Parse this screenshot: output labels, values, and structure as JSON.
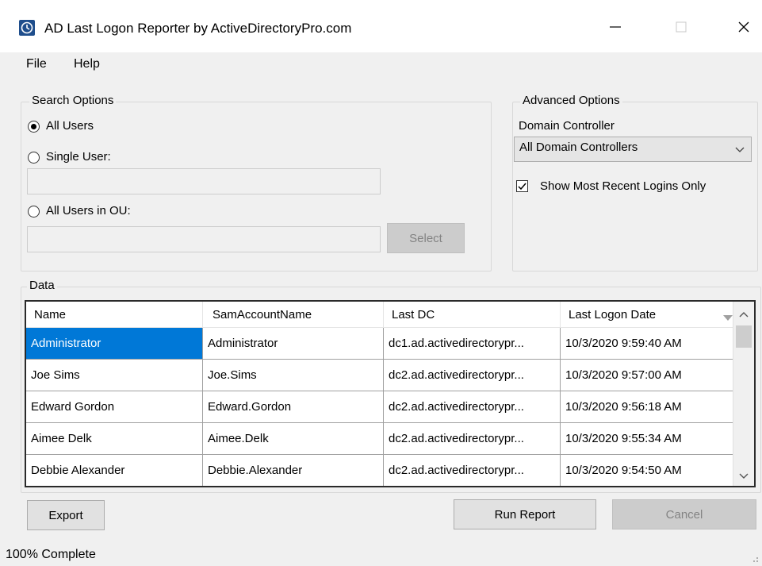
{
  "window": {
    "title": "AD Last Logon Reporter by ActiveDirectoryPro.com"
  },
  "menu": {
    "items": [
      "File",
      "Help"
    ]
  },
  "search_options": {
    "title": "Search Options",
    "all_users": "All Users",
    "single_user": "Single User:",
    "all_users_ou": "All Users in OU:",
    "select_button": "Select"
  },
  "advanced_options": {
    "title": "Advanced Options",
    "dc_label": "Domain Controller",
    "dc_selected": "All Domain Controllers",
    "recent_only": "Show Most Recent Logins Only"
  },
  "data_group": {
    "title": "Data"
  },
  "grid": {
    "columns": [
      "Name",
      "SamAccountName",
      "Last DC",
      "Last Logon Date"
    ],
    "rows": [
      [
        "Administrator",
        "Administrator",
        "dc1.ad.activedirectorypr...",
        "10/3/2020 9:59:40 AM"
      ],
      [
        "Joe Sims",
        "Joe.Sims",
        "dc2.ad.activedirectorypr...",
        "10/3/2020 9:57:00 AM"
      ],
      [
        "Edward Gordon",
        "Edward.Gordon",
        "dc2.ad.activedirectorypr...",
        "10/3/2020 9:56:18 AM"
      ],
      [
        "Aimee Delk",
        "Aimee.Delk",
        "dc2.ad.activedirectorypr...",
        "10/3/2020 9:55:34 AM"
      ],
      [
        "Debbie Alexander",
        "Debbie.Alexander",
        "dc2.ad.activedirectorypr...",
        "10/3/2020 9:54:50 AM"
      ]
    ]
  },
  "buttons": {
    "export": "Export",
    "run_report": "Run Report",
    "cancel": "Cancel"
  },
  "status": {
    "text": "100% Complete"
  },
  "colors": {
    "selection": "#0078d7",
    "app_icon": "#1f4e8c"
  }
}
